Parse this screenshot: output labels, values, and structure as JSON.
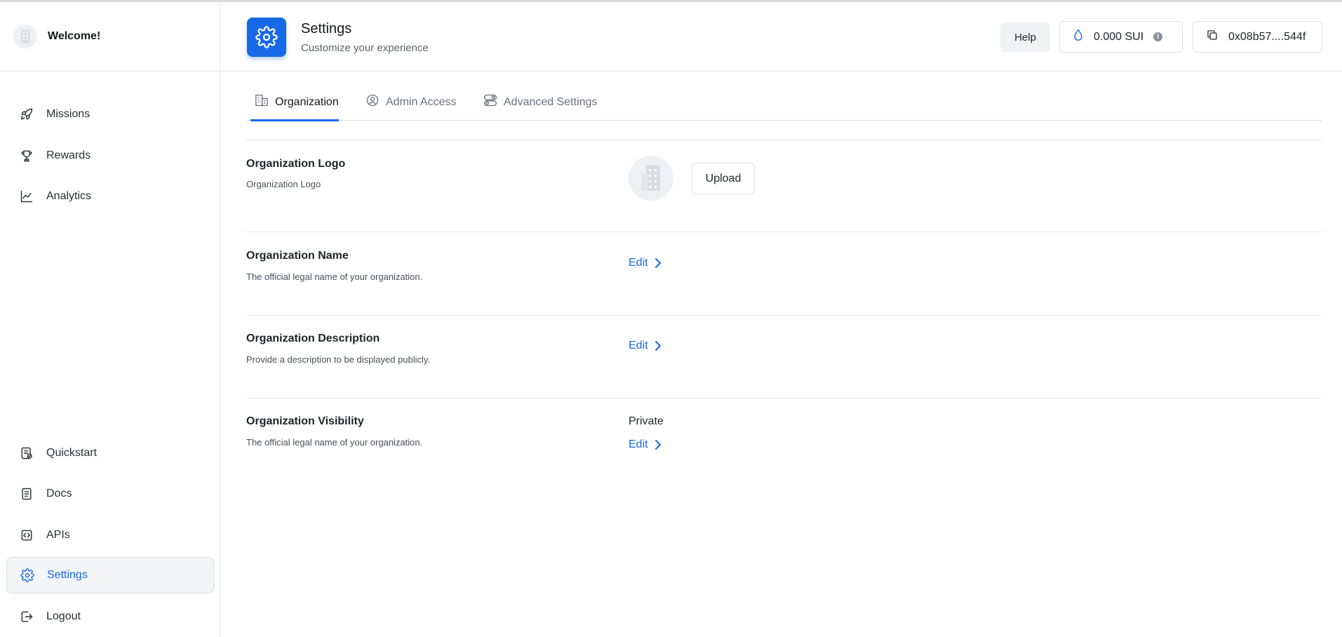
{
  "sidebar": {
    "brand_title": "Welcome!",
    "top_items": [
      {
        "label": "Missions",
        "icon": "rocket-icon"
      },
      {
        "label": "Rewards",
        "icon": "trophy-icon"
      },
      {
        "label": "Analytics",
        "icon": "line-chart-icon"
      }
    ],
    "bottom_items": [
      {
        "label": "Quickstart",
        "icon": "checklist-icon"
      },
      {
        "label": "Docs",
        "icon": "document-icon"
      },
      {
        "label": "APIs",
        "icon": "code-icon"
      },
      {
        "label": "Settings",
        "icon": "gear-icon",
        "active": true
      },
      {
        "label": "Logout",
        "icon": "logout-icon"
      }
    ]
  },
  "header": {
    "title": "Settings",
    "subtitle": "Customize your experience",
    "help_label": "Help",
    "balance": "0.000 SUI",
    "address": "0x08b57....544f"
  },
  "tabs": [
    {
      "label": "Organization",
      "icon": "building-icon",
      "active": true
    },
    {
      "label": "Admin Access",
      "icon": "user-circle-icon"
    },
    {
      "label": "Advanced Settings",
      "icon": "toggles-icon"
    }
  ],
  "sections": {
    "logo": {
      "title": "Organization Logo",
      "description": "Organization Logo",
      "button_label": "Upload"
    },
    "name": {
      "title": "Organization Name",
      "description": "The official legal name of your organization.",
      "action_label": "Edit"
    },
    "description": {
      "title": "Organization Description",
      "description": "Provide a description to be displayed publicly.",
      "action_label": "Edit"
    },
    "visibility": {
      "title": "Organization Visibility",
      "description": "The official legal name of your organization.",
      "value": "Private",
      "action_label": "Edit"
    }
  },
  "colors": {
    "accent": "#1769e8",
    "border": "#e4e6ea",
    "text": "#1f2328",
    "muted": "#5d636e"
  }
}
